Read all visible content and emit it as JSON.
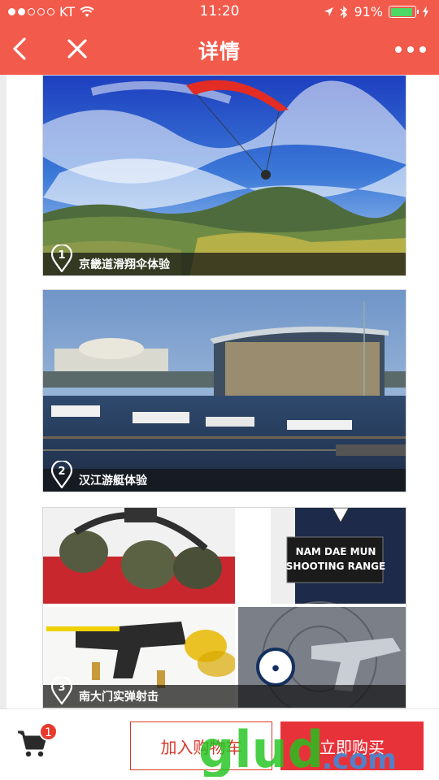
{
  "status": {
    "carrier": "KT",
    "time": "11:20",
    "battery": "91%",
    "battery_level": 0.91
  },
  "nav": {
    "title": "详情"
  },
  "cards": [
    {
      "caption": "京畿道滑翔伞体验",
      "number": "1"
    },
    {
      "caption": "汉江游艇体验",
      "number": "2"
    },
    {
      "caption": "南大门实弹射击",
      "number": "3",
      "sign_line1": "NAM DAE MUN",
      "sign_line2": "SHOOTING RANGE"
    }
  ],
  "bottom": {
    "cart_count": "1",
    "add_to_cart": "加入购物车",
    "buy_now": "立即购买"
  },
  "watermark": {
    "text": "glud",
    "suffix": ".com"
  },
  "colors": {
    "header": "#f25a4b",
    "buy": "#e8323a",
    "accent": "#d8382b"
  }
}
